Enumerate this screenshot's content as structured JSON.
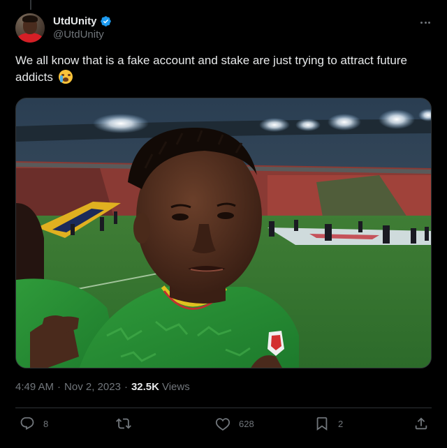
{
  "author": {
    "display_name": "UtdUnity",
    "handle": "@UtdUnity",
    "verified": true,
    "avatar_icon": "profile-photo"
  },
  "tweet": {
    "text": "We all know that is a fake account and stake are just trying to attract future addicts",
    "emoji": "crying-face-emoji"
  },
  "media": {
    "description_icon": "photo-football-player-stadium"
  },
  "meta": {
    "time": "4:49 AM",
    "separator": "·",
    "date": "Nov 2, 2023",
    "views_count": "32.5K",
    "views_label": "Views"
  },
  "actions": {
    "replies": "8",
    "retweets": "",
    "likes": "628",
    "bookmarks": "2"
  },
  "colors": {
    "background": "#000000",
    "text_primary": "#e7e9ea",
    "text_secondary": "#71767b",
    "divider": "#2f3336",
    "verified_blue": "#1d9bf0"
  }
}
